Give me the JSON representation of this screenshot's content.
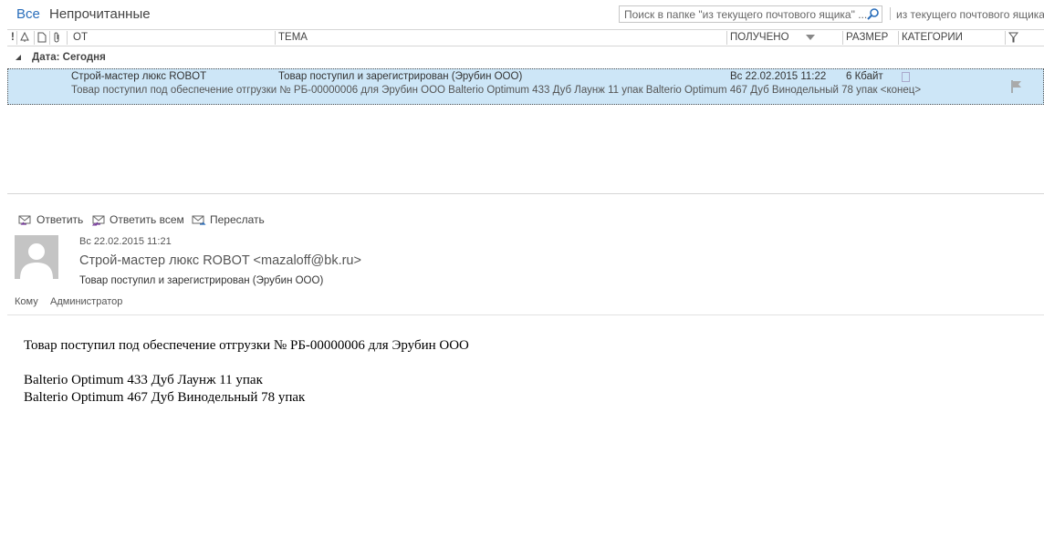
{
  "filter": {
    "all": "Все",
    "unread": "Непрочитанные"
  },
  "search": {
    "placeholder": "Поиск в папке \"из текущего почтового ящика\" ...",
    "scope": "из текущего почтового ящика"
  },
  "columns": {
    "importance": "!",
    "from": "ОТ",
    "subject": "ТЕМА",
    "received": "ПОЛУЧЕНО",
    "size": "РАЗМЕР",
    "categories": "КАТЕГОРИИ"
  },
  "group": {
    "label": "Дата: Сегодня"
  },
  "message": {
    "from": "Строй-мастер люкс ROBOT",
    "subject": "Товар поступил и зарегистрирован (Эрубин ООО)",
    "received": "Вс 22.02.2015 11:22",
    "size": "6 Кбайт",
    "preview": "Товар поступил под обеспечение отгрузки № РБ-00000006 для Эрубин ООО  Balterio Optimum 433 Дуб Лаунж 11 упак  Balterio Optimum 467 Дуб Винодельный 78 упак <конец>"
  },
  "actions": {
    "reply": "Ответить",
    "reply_all": "Ответить всем",
    "forward": "Переслать"
  },
  "reading": {
    "date": "Вс 22.02.2015 11:21",
    "from": "Строй-мастер люкс ROBOT <mazaloff@bk.ru>",
    "subject": "Товар поступил и зарегистрирован (Эрубин ООО)",
    "to_label": "Кому",
    "to_value": "Администратор"
  },
  "body": {
    "line1": "Товар поступил под обеспечение отгрузки № РБ-00000006 для Эрубин ООО",
    "line2": "Balterio Optimum 433 Дуб Лаунж 11 упак",
    "line3": "Balterio Optimum 467 Дуб Винодельный 78 упак"
  },
  "colors": {
    "accent": "#2a6ebb",
    "selection": "#cde6f7"
  }
}
